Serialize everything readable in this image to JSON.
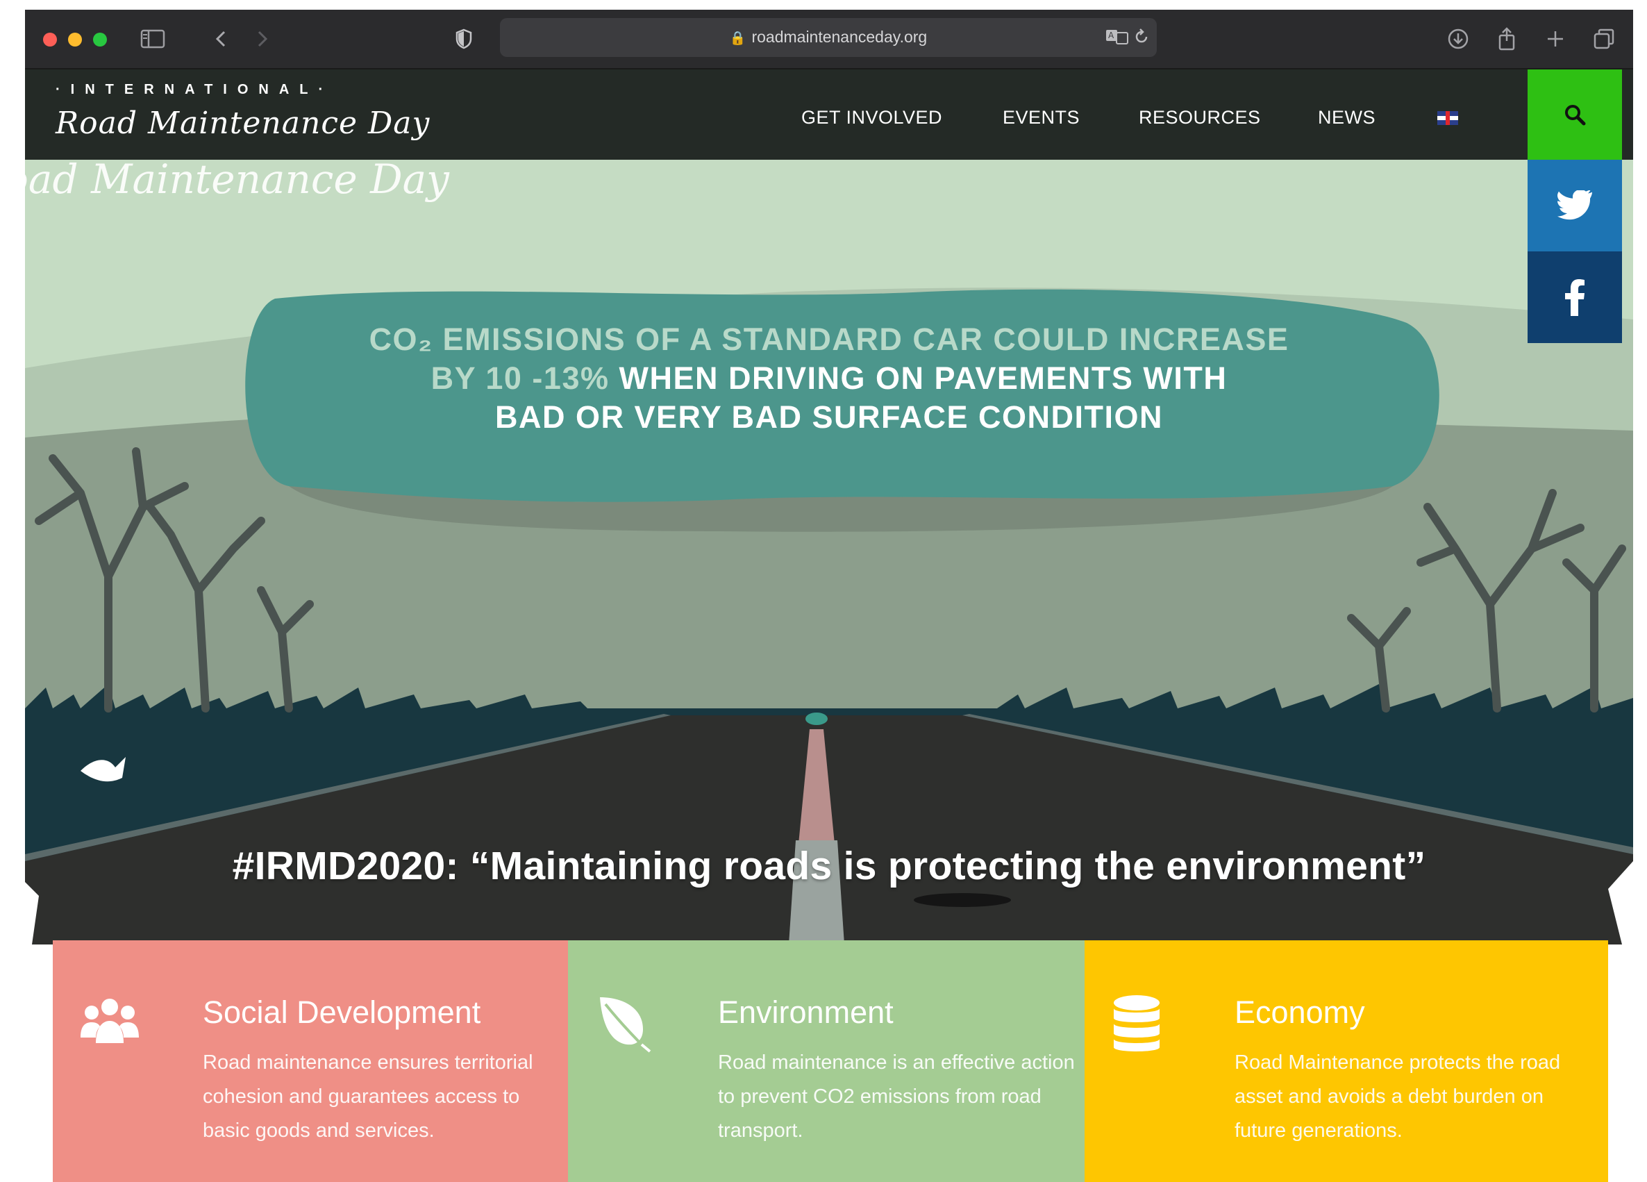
{
  "browser": {
    "url": "roadmaintenanceday.org",
    "icons": [
      "sidebar-icon",
      "back-icon",
      "forward-icon",
      "shield-icon",
      "translate-icon",
      "reload-icon",
      "download-icon",
      "share-icon",
      "new-tab-icon",
      "tabs-overview-icon"
    ]
  },
  "header": {
    "logo_top": "·INTERNATIONAL·",
    "logo_script": "Road Maintenance Day",
    "nav": [
      "GET INVOLVED",
      "EVENTS",
      "RESOURCES",
      "NEWS"
    ],
    "language_icon": "uk-flag-icon",
    "search_icon": "search-icon",
    "search_color": "#2ec013"
  },
  "hero": {
    "watermark": "oad Maintenance Day",
    "bubble_line1": "CO₂ EMISSIONS OF A STANDARD CAR COULD INCREASE",
    "bubble_line2_muted": "BY 10 -13%",
    "bubble_line2_rest": " WHEN DRIVING ON PAVEMENTS WITH",
    "bubble_line3": "BAD OR VERY BAD SURFACE CONDITION",
    "title": "#IRMD2020: “Maintaining roads is protecting the environment”"
  },
  "social": {
    "twitter_color": "#1d74b3",
    "facebook_color": "#0f3f6e"
  },
  "features": [
    {
      "icon": "users-icon",
      "title": "Social Development",
      "text": "Road maintenance ensures territorial cohesion and guarantees access to basic goods and services.",
      "color": "#ef8f86"
    },
    {
      "icon": "leaf-icon",
      "title": "Environment",
      "text": "Road maintenance is an effective action to prevent CO2 emissions from road transport.",
      "color": "#a4cc93"
    },
    {
      "icon": "database-icon",
      "title": "Economy",
      "text": "Road Maintenance protects the road asset and avoids a debt burden on future generations.",
      "color": "#fec601"
    }
  ]
}
